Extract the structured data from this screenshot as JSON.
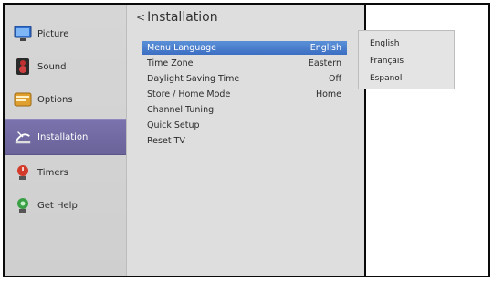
{
  "sidebar": {
    "items": [
      {
        "label": "Picture",
        "icon": "picture-icon"
      },
      {
        "label": "Sound",
        "icon": "speaker-icon"
      },
      {
        "label": "Options",
        "icon": "options-icon"
      },
      {
        "label": "Installation",
        "icon": "satellite-dish-icon"
      },
      {
        "label": "Timers",
        "icon": "timer-icon"
      },
      {
        "label": "Get Help",
        "icon": "help-icon"
      }
    ],
    "active_index": 3
  },
  "panel": {
    "title": "Installation",
    "back_glyph": "<",
    "rows": [
      {
        "label": "Menu Language",
        "value": "English"
      },
      {
        "label": "Time Zone",
        "value": "Eastern"
      },
      {
        "label": "Daylight Saving Time",
        "value": "Off"
      },
      {
        "label": "Store / Home Mode",
        "value": "Home"
      },
      {
        "label": "Channel Tuning",
        "value": ""
      },
      {
        "label": "Quick Setup",
        "value": ""
      },
      {
        "label": "Reset TV",
        "value": ""
      }
    ]
  },
  "language_popup": {
    "options": [
      "English",
      "Français",
      "Espanol"
    ]
  },
  "colors": {
    "selection": "#4a7fcf",
    "sidebar_active": "#716aa4"
  }
}
